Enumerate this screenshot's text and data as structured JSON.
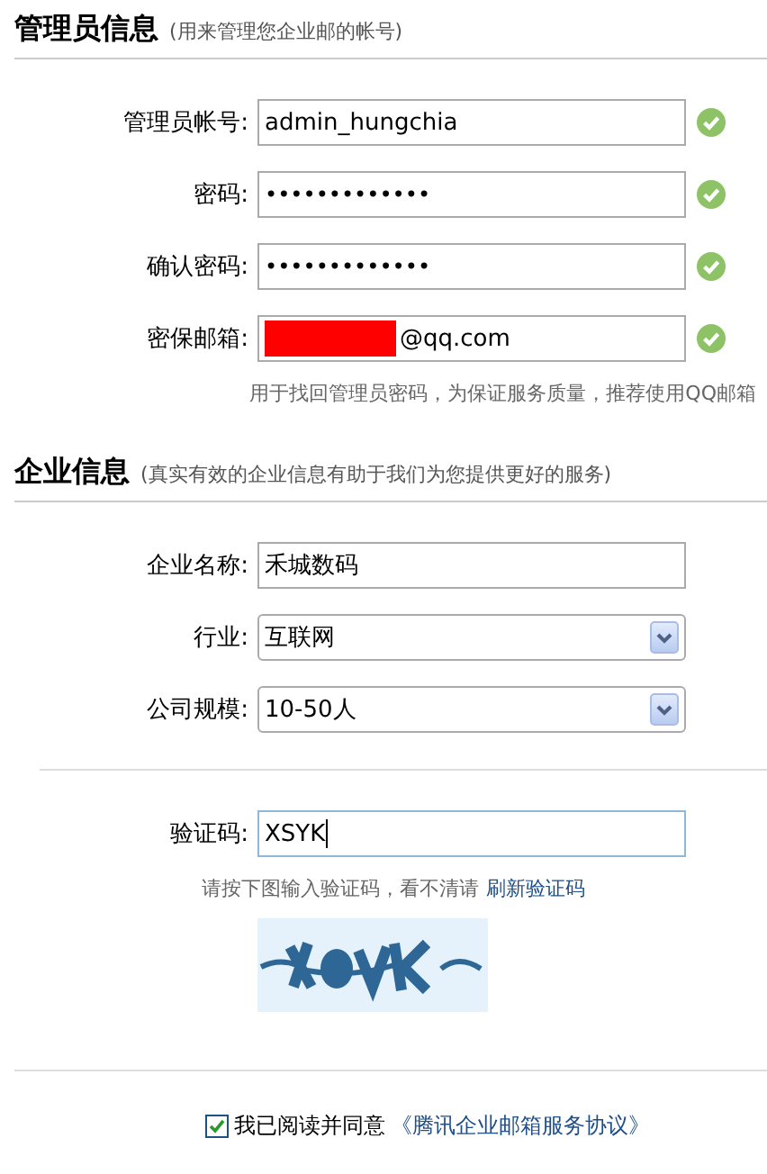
{
  "admin_section": {
    "title": "管理员信息",
    "subtitle": "(用来管理您企业邮的帐号)",
    "fields": [
      {
        "label": "管理员帐号:",
        "kind": "text",
        "value": "admin_hungchia",
        "valid": true
      },
      {
        "label": "密码:",
        "kind": "password",
        "value": "•••••••••••••",
        "valid": true
      },
      {
        "label": "确认密码:",
        "kind": "password",
        "value": "•••••••••••••",
        "valid": true
      },
      {
        "label": "密保邮箱:",
        "kind": "email",
        "value": "@qq.com",
        "redacted": true,
        "valid": true
      }
    ],
    "hint": "用于找回管理员密码，为保证服务质量，推荐使用QQ邮箱"
  },
  "company_section": {
    "title": "企业信息",
    "subtitle": "(真实有效的企业信息有助于我们为您提供更好的服务)",
    "fields": [
      {
        "label": "企业名称:",
        "kind": "text",
        "value": "禾城数码"
      },
      {
        "label": "行业:",
        "kind": "select",
        "value": "互联网"
      },
      {
        "label": "公司规模:",
        "kind": "select",
        "value": "10-50人"
      }
    ]
  },
  "captcha": {
    "label": "验证码:",
    "value": "XSYK",
    "focused": true,
    "hint": "请按下图输入验证码，看不清请",
    "refresh_link": "刷新验证码"
  },
  "agreement": {
    "checked": true,
    "text": "我已阅读并同意",
    "link": "《腾讯企业邮箱服务协议》"
  }
}
